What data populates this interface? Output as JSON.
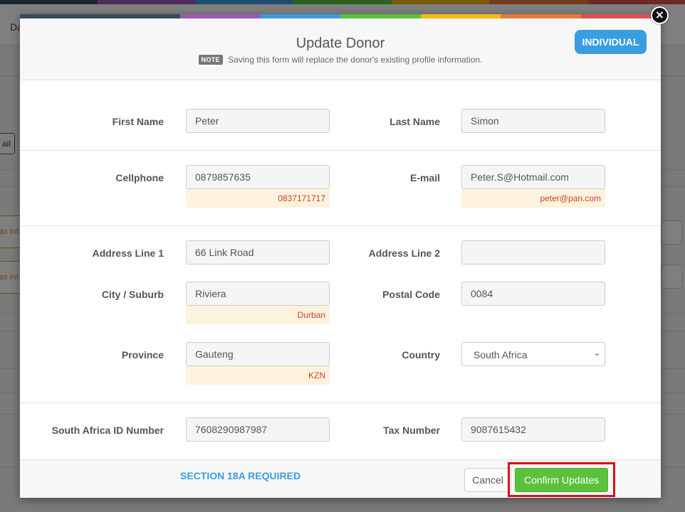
{
  "background": {
    "tab_label": "Da",
    "btn_text": "ail",
    "orange_text": "ax Inf",
    "stripe_colors": [
      "#e07b39",
      "#9b59b6",
      "#3a9de2",
      "#5cc13a",
      "#f2b90f",
      "#e8793a",
      "#d9534f"
    ]
  },
  "modal": {
    "title": "Update Donor",
    "note_badge": "NOTE",
    "note_text": "Saving this form will replace the donor's existing profile information.",
    "type_button": "INDIVIDUAL",
    "close_icon": "×"
  },
  "fields": {
    "first_name": {
      "label": "First Name",
      "value": "Peter"
    },
    "last_name": {
      "label": "Last Name",
      "value": "Simon"
    },
    "cellphone": {
      "label": "Cellphone",
      "value": "0879857635",
      "old": "0837171717"
    },
    "email": {
      "label": "E-mail",
      "value": "Peter.S@Hotmail.com",
      "old": "peter@pan.com"
    },
    "address1": {
      "label": "Address Line 1",
      "value": "66 Link Road"
    },
    "address2": {
      "label": "Address Line 2",
      "value": ""
    },
    "city": {
      "label": "City / Suburb",
      "value": "Riviera",
      "old": "Durban"
    },
    "postal": {
      "label": "Postal Code",
      "value": "0084"
    },
    "province": {
      "label": "Province",
      "value": "Gauteng",
      "old": "KZN"
    },
    "country": {
      "label": "Country",
      "value": "South Africa"
    },
    "id_number": {
      "label": "South Africa ID Number",
      "value": "7608290987987"
    },
    "tax_number": {
      "label": "Tax Number",
      "value": "9087615432"
    }
  },
  "footer": {
    "section18a": "SECTION 18A REQUIRED",
    "cancel": "Cancel",
    "confirm": "Confirm Updates"
  },
  "colors": {
    "accent_blue": "#3a9de2",
    "confirm_green": "#5cc13a",
    "highlight_red": "#d9101a",
    "old_value_bg": "#fdf2dd",
    "old_value_text": "#c9452b"
  }
}
